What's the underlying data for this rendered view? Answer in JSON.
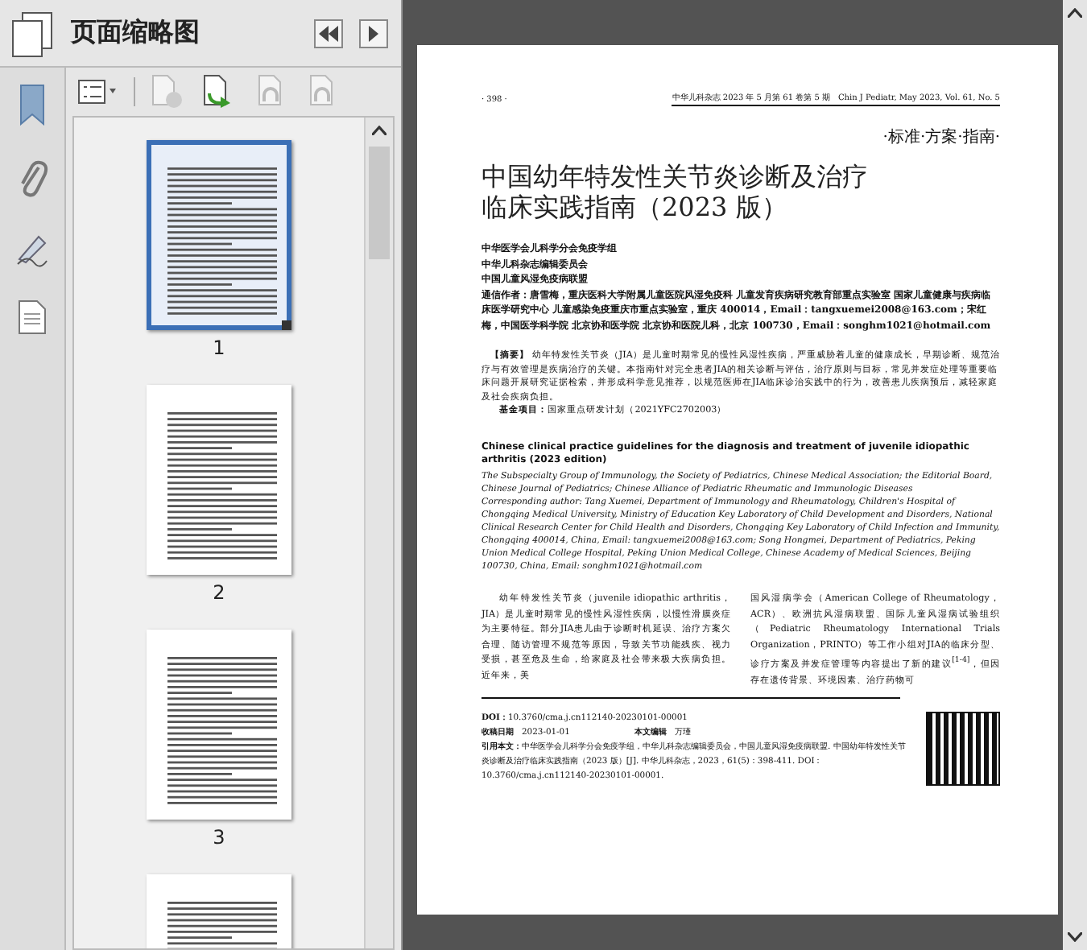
{
  "sidebar": {
    "title": "页面缩略图",
    "toolbar": [
      {
        "disabled": false
      },
      {
        "disabled": true
      },
      {
        "disabled": false
      },
      {
        "disabled": true
      },
      {
        "disabled": true
      }
    ],
    "thumbnails": [
      {
        "label": "1",
        "selected": true
      },
      {
        "label": "2",
        "selected": false
      },
      {
        "label": "3",
        "selected": false
      },
      {
        "selected": false
      }
    ]
  },
  "document": {
    "page_number": "· 398 ·",
    "running_header": "中华儿科杂志 2023 年 5 月第 61 卷第 5 期　Chin J Pediatr, May 2023, Vol. 61, No. 5",
    "section": "·标准·方案·指南·",
    "title": [
      "中国幼年特发性关节炎诊断及治疗",
      "临床实践指南（2023 版）"
    ],
    "authors": [
      "中华医学会儿科学分会免疫学组",
      "中华儿科杂志编辑委员会",
      "中国儿童风湿免疫病联盟"
    ],
    "correspondence": "通信作者：唐雪梅，重庆医科大学附属儿童医院风湿免疫科 儿童发育疾病研究教育部重点实验室 国家儿童健康与疾病临床医学研究中心 儿童感染免疫重庆市重点实验室，重庆 400014，Email：tangxuemei2008@163.com；宋红梅，中国医学科学院 北京协和医学院 北京协和医院儿科，北京 100730，Email：songhm1021@hotmail.com",
    "abstract": "**【摘要】** 幼年特发性关节炎（JIA）是儿童时期常见的慢性风湿性疾病，严重威胁着儿童的健康成长，早期诊断、规范治疗与有效管理是疾病治疗的关键。本指南针对完全患者JIA的相关诊断与评估，治疗原则与目标，常见并发症处理等重要临床问题开展研究证据检索，并形成科学意见推荐，以规范医师在JIA临床诊治实践中的行为，改善患儿疾病预后，减轻家庭及社会疾病负担。",
    "fund": "**基金项目：**国家重点研发计划（2021YFC2702003）",
    "english_title": "Chinese clinical practice guidelines for the diagnosis and treatment of juvenile idiopathic arthritis (2023 edition)",
    "english_authors": "The Subspecialty Group of Immunology, the Society of Pediatrics, Chinese Medical Association; the Editorial Board, Chinese Journal of Pediatrics; Chinese Alliance of Pediatric Rheumatic and Immunologic Diseases",
    "english_correspondence": "Corresponding author: Tang Xuemei, Department of Immunology and Rheumatology, Children's Hospital of Chongqing Medical University, Ministry of Education Key Laboratory of Child Development and Disorders, National Clinical Research Center for Child Health and Disorders, Chongqing Key Laboratory of Child Infection and Immunity, Chongqing 400014, China, Email: tangxuemei2008@163.com; Song Hongmei, Department of Pediatrics, Peking Union Medical College Hospital, Peking Union Medical College, Chinese Academy of Medical Sciences, Beijing 100730, China, Email: songhm1021@hotmail.com",
    "body": [
      "幼年特发性关节炎（juvenile idiopathic arthritis，JIA）是儿童时期常见的慢性风湿性疾病，以慢性滑膜炎症为主要特征。部分JIA患儿由于诊断时机延误、治疗方案欠合理、随访管理不规范等原因，导致关节功能残疾、视力受损，甚至危及生命，给家庭及社会带来极大疾病负担。近年来，美",
      "国风湿病学会（American College of Rheumatology，ACR）、欧洲抗风湿病联盟、国际儿童风湿病试验组织（Pediatric Rheumatology International Trials Organization，PRINTO）等工作小组对JIA的临床分型、诊疗方案及并发症管理等内容提出了新的建议$^{[1-4]}$，但因存在遗传背景、环境因素、治疗药物可"
    ],
    "doi": "**DOI：**10.3760/cma.j.cn112140-20230101-00001",
    "received": "**收稿日期**　2023-01-01",
    "editor": "**本文编辑**　万瑾",
    "citation": "**引用本文：**中华医学会儿科学分会免疫学组，中华儿科杂志编辑委员会，中国儿童风湿免疫病联盟. 中国幼年特发性关节炎诊断及治疗临床实践指南（2023 版）[J]. 中华儿科杂志，2023，61(5)：398-411. DOI：10.3760/cma.j.cn112140-20230101-00001."
  }
}
